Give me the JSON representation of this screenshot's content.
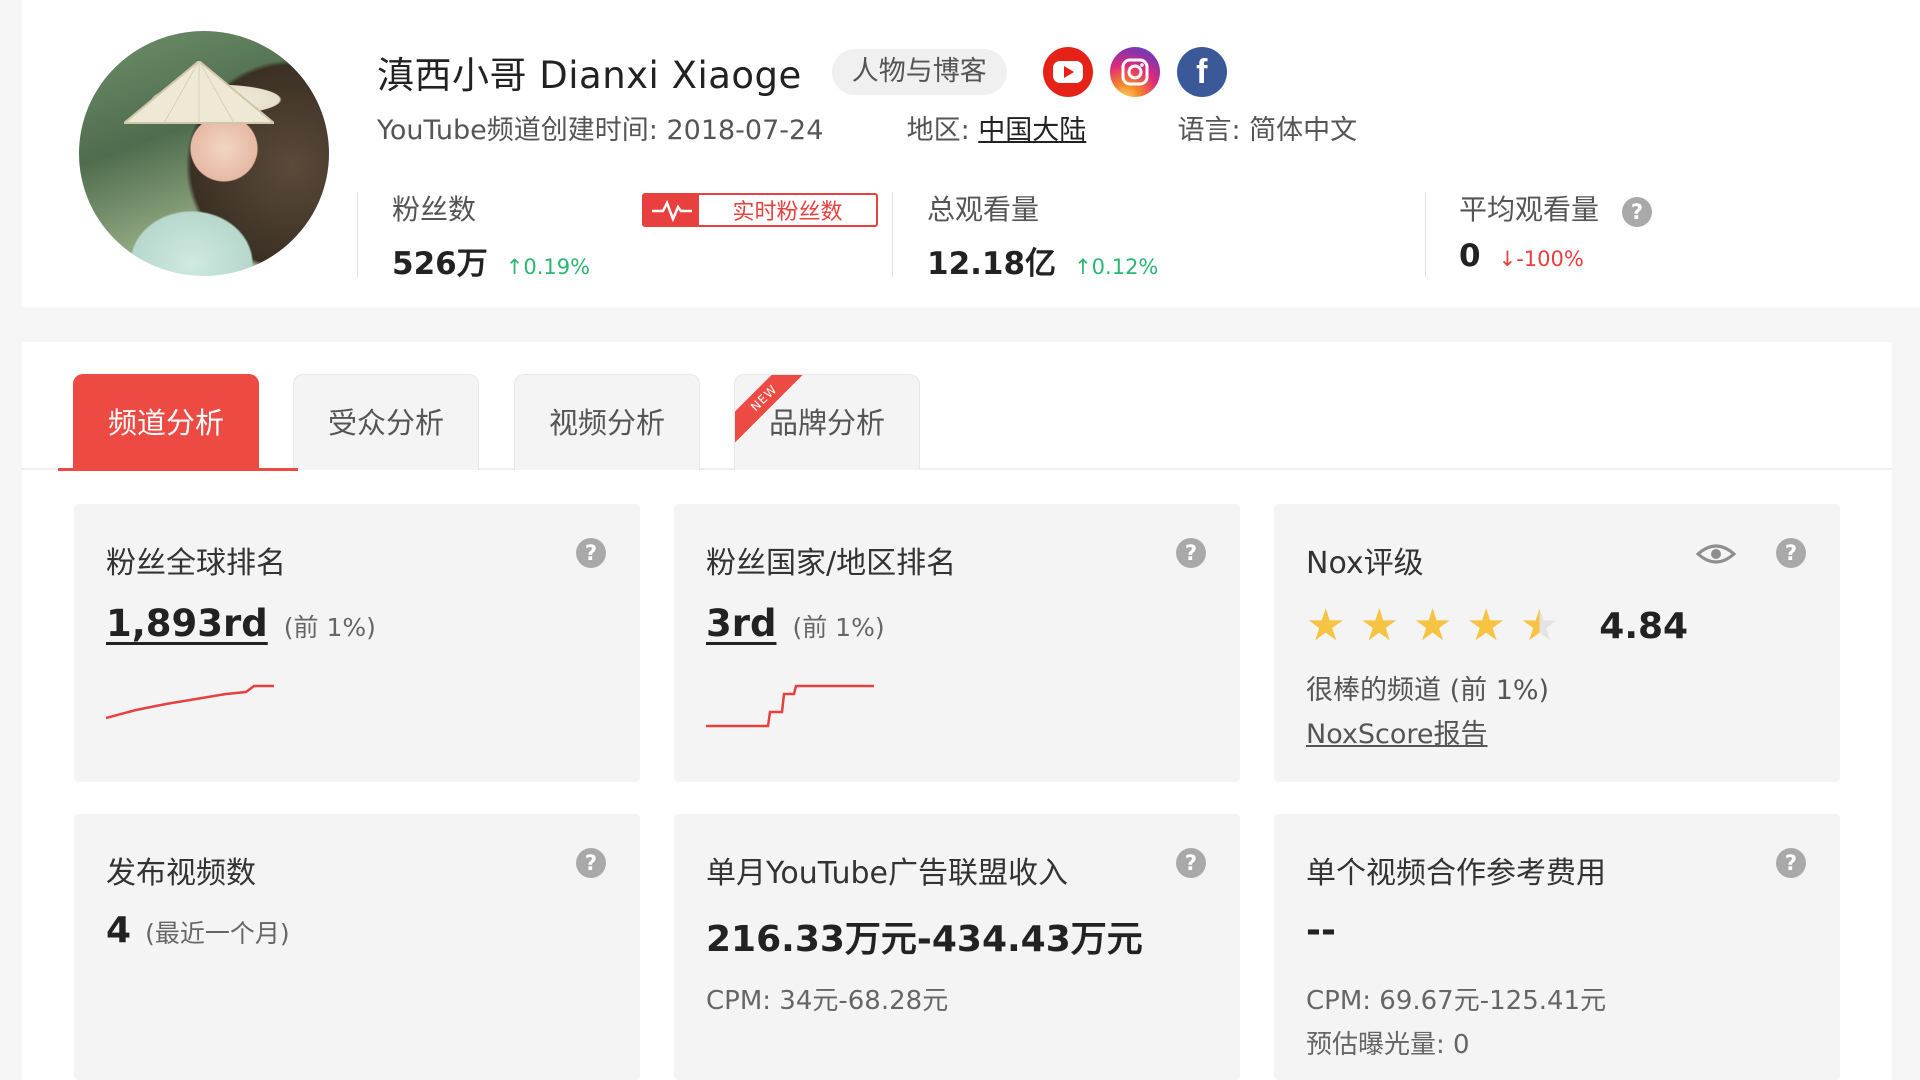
{
  "header": {
    "channel_name": "滇西小哥 Dianxi Xiaoge",
    "category": "人物与博客",
    "social_icons": [
      "youtube-icon",
      "instagram-icon",
      "facebook-icon"
    ],
    "created_label": "YouTube频道创建时间: 2018-07-24",
    "region_label": "地区: ",
    "region_value": "中国大陆",
    "language_label": "语言: 简体中文"
  },
  "stats": {
    "subscribers": {
      "label": "粉丝数",
      "value": "526万",
      "change": "0.19%",
      "direction": "up"
    },
    "realtime_button": "实时粉丝数",
    "total_views": {
      "label": "总观看量",
      "value": "12.18亿",
      "change": "0.12%",
      "direction": "up"
    },
    "avg_views": {
      "label": "平均观看量",
      "value": "0",
      "change": "-100%",
      "direction": "down"
    }
  },
  "tabs": [
    {
      "label": "频道分析",
      "active": true
    },
    {
      "label": "受众分析",
      "active": false
    },
    {
      "label": "视频分析",
      "active": false
    },
    {
      "label": "品牌分析",
      "active": false,
      "badge": "NEW"
    }
  ],
  "cards": {
    "global_rank": {
      "title": "粉丝全球排名",
      "value": "1,893rd",
      "note": "(前 1%)"
    },
    "country_rank": {
      "title": "粉丝国家/地区排名",
      "value": "3rd",
      "note": "(前 1%)"
    },
    "nox_rating": {
      "title": "Nox评级",
      "stars": 4.84,
      "score": "4.84",
      "description": "很棒的频道 (前 1%)",
      "report_link": "NoxScore报告"
    },
    "videos_published": {
      "title": "发布视频数",
      "value": "4",
      "note": "(最近一个月)"
    },
    "monthly_revenue": {
      "title": "单月YouTube广告联盟收入",
      "value": "216.33万元-434.43万元",
      "cpm": "CPM: 34元-68.28元"
    },
    "collab_fee": {
      "title": "单个视频合作参考费用",
      "value": "--",
      "cpm": "CPM: 69.67元-125.41元",
      "exposure": "预估曝光量: 0"
    }
  },
  "colors": {
    "accent": "#ee4a44",
    "up": "#2bb673",
    "down": "#e8403e",
    "star": "#f6c343"
  }
}
